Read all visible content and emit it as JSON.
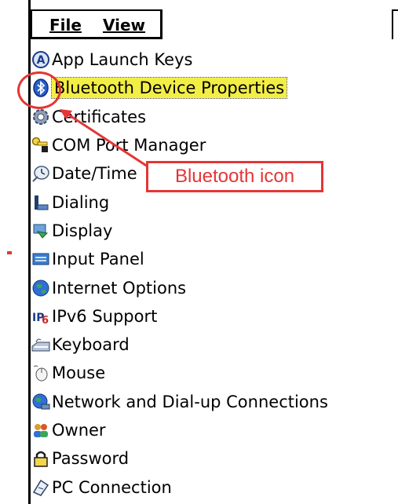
{
  "menu": {
    "file_label": "File",
    "view_label": "View"
  },
  "items": [
    {
      "label": "App Launch Keys",
      "icon": "app-launch-keys-icon"
    },
    {
      "label": "Bluetooth Device Properties",
      "icon": "bluetooth-icon",
      "selected": true
    },
    {
      "label": "Certificates",
      "icon": "certificates-gear-icon"
    },
    {
      "label": "COM Port Manager",
      "icon": "com-port-key-icon"
    },
    {
      "label": "Date/Time",
      "icon": "date-time-clock-icon"
    },
    {
      "label": "Dialing",
      "icon": "dialing-phone-icon"
    },
    {
      "label": "Display",
      "icon": "display-icon"
    },
    {
      "label": "Input Panel",
      "icon": "input-panel-keyboard-icon"
    },
    {
      "label": "Internet Options",
      "icon": "internet-globe-icon"
    },
    {
      "label": "IPv6 Support",
      "icon": "ipv6-icon"
    },
    {
      "label": "Keyboard",
      "icon": "keyboard-icon"
    },
    {
      "label": "Mouse",
      "icon": "mouse-icon"
    },
    {
      "label": "Network and Dial-up Connections",
      "icon": "network-icon"
    },
    {
      "label": "Owner",
      "icon": "owner-people-icon"
    },
    {
      "label": "Password",
      "icon": "password-lock-icon"
    },
    {
      "label": "PC Connection",
      "icon": "pc-connection-icon"
    }
  ],
  "annotation": {
    "label": "Bluetooth icon"
  },
  "colors": {
    "highlight": "#f3ee45",
    "annotation": "#e53535"
  }
}
